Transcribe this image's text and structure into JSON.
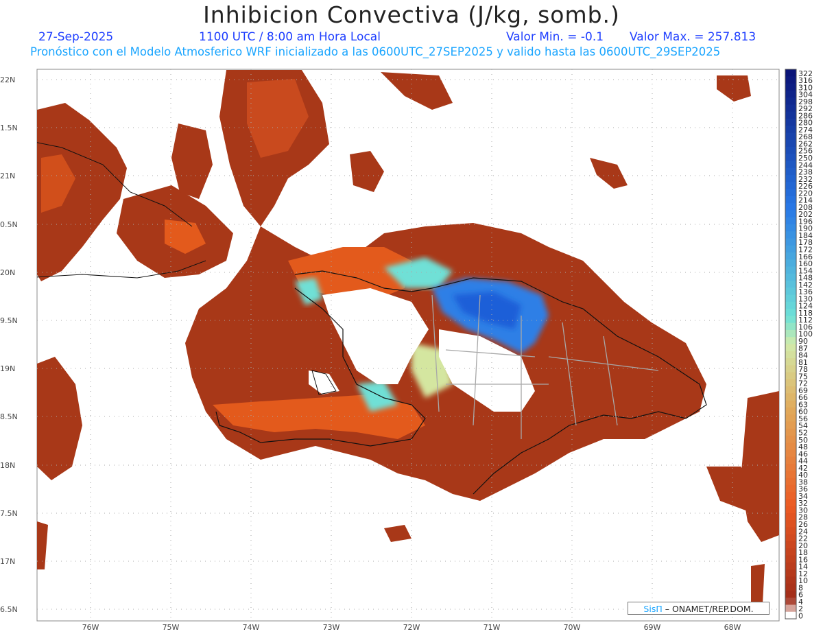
{
  "header": {
    "title": "Inhibicion Convectiva (J/kg, somb.)",
    "date": "27-Sep-2025",
    "time": "1100 UTC / 8:00 am Hora Local",
    "valmin": "Valor Min. = -0.1",
    "valmax": "Valor Max. = 257.813",
    "forecast": "Pronóstico con el Modelo Atmosferico WRF inicializado a las 0600UTC_27SEP2025 y valido hasta las  0600UTC_29SEP2025"
  },
  "axes": {
    "lat_labels": [
      "22N",
      "1.5N",
      "21N",
      "0.5N",
      "20N",
      "9.5N",
      "19N",
      "8.5N",
      "18N",
      "7.5N",
      "17N",
      "6.5N"
    ],
    "lon_labels": [
      "76W",
      "75W",
      "74W",
      "73W",
      "72W",
      "71W",
      "70W",
      "69W",
      "68W"
    ]
  },
  "colorbar": {
    "labels": [
      "322",
      "316",
      "310",
      "304",
      "298",
      "292",
      "286",
      "280",
      "274",
      "268",
      "262",
      "256",
      "250",
      "244",
      "238",
      "232",
      "226",
      "220",
      "214",
      "208",
      "202",
      "196",
      "190",
      "184",
      "178",
      "172",
      "166",
      "160",
      "154",
      "148",
      "142",
      "136",
      "130",
      "124",
      "118",
      "112",
      "106",
      "100",
      "90",
      "87",
      "84",
      "81",
      "78",
      "75",
      "72",
      "69",
      "66",
      "63",
      "60",
      "56",
      "54",
      "52",
      "50",
      "48",
      "46",
      "44",
      "42",
      "40",
      "38",
      "36",
      "34",
      "32",
      "30",
      "28",
      "26",
      "24",
      "22",
      "20",
      "18",
      "16",
      "14",
      "12",
      "10",
      "8",
      "6",
      "4",
      "2",
      "0"
    ]
  },
  "credit": {
    "brand": "SisΠ",
    "org": "– ONAMET/REP.DOM."
  },
  "colors": {
    "low": "#a83818",
    "mid": "#e35a1c",
    "yellowgreen": "#d4e6a0",
    "cyan": "#6fe0d6",
    "blue": "#2f7fe6",
    "deepblue": "#0a1f8a",
    "title_blue": "#1f3fff",
    "forecast_cyan": "#1aa5ff"
  }
}
